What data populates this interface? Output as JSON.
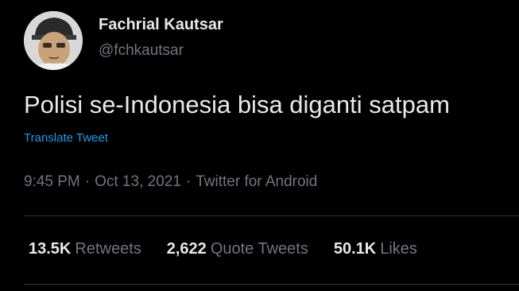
{
  "author": {
    "display_name": "Fachrial Kautsar",
    "handle": "@fchkautsar"
  },
  "tweet": {
    "text": "Polisi se-Indonesia bisa diganti satpam",
    "translate_label": "Translate Tweet",
    "time": "9:45 PM",
    "date": "Oct 13, 2021",
    "source": "Twitter for Android",
    "separator": "·"
  },
  "stats": {
    "retweets_count": "13.5K",
    "retweets_label": "Retweets",
    "quotes_count": "2,622",
    "quotes_label": "Quote Tweets",
    "likes_count": "50.1K",
    "likes_label": "Likes"
  },
  "colors": {
    "background": "#000000",
    "primary_text": "#e7e9ea",
    "secondary_text": "#71767b",
    "link": "#1d9bf0",
    "divider": "#2f3336"
  }
}
